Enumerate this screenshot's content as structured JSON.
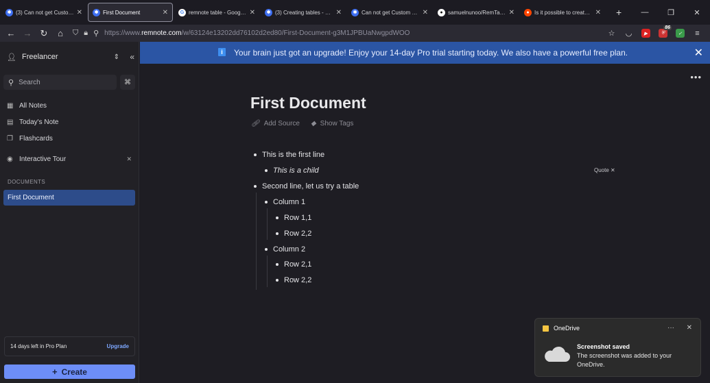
{
  "browser": {
    "tabs": [
      {
        "title": "(3) Can not get Custom CSS",
        "icon": "remnote-icon",
        "active": false
      },
      {
        "title": "First Document",
        "icon": "remnote-icon",
        "active": true
      },
      {
        "title": "remnote table - Google Search",
        "icon": "google-icon",
        "active": false
      },
      {
        "title": "(3) Creating tables - Extensions",
        "icon": "remnote-icon",
        "active": false
      },
      {
        "title": "Can not get Custom CSS",
        "icon": "remnote-icon",
        "active": false
      },
      {
        "title": "samuelnunoo/RemTable",
        "icon": "github-icon",
        "active": false
      },
      {
        "title": "Is it possible to create tables",
        "icon": "reddit-icon",
        "active": false
      }
    ],
    "url_prefix": "https://www.",
    "url_host": "remnote.com",
    "url_path": "/w/63124e13202dd76102d2ed80/First-Document-g3M1JPBUaNwgpdWOO",
    "extension_badge": "86"
  },
  "sidebar": {
    "workspace": "Freelancer",
    "search_placeholder": "Search",
    "search_shortcut": "⌘",
    "nav": [
      {
        "label": "All Notes",
        "icon": "grid-icon"
      },
      {
        "label": "Today's Note",
        "icon": "calendar-icon"
      },
      {
        "label": "Flashcards",
        "icon": "cards-icon"
      },
      {
        "label": "Interactive Tour",
        "icon": "rocket-icon"
      }
    ],
    "documents_header": "DOCUMENTS",
    "documents": [
      "First Document"
    ],
    "trial_text": "14 days left in Pro Plan",
    "upgrade_label": "Upgrade",
    "create_label": "Create"
  },
  "banner": {
    "message": "Your brain just got an upgrade! Enjoy your 14-day Pro trial starting today. We also have a powerful free plan."
  },
  "document": {
    "title": "First Document",
    "add_source": "Add Source",
    "show_tags": "Show Tags",
    "quote_label": "Quote",
    "bullets": [
      {
        "text": "This is the first line",
        "level": 0
      },
      {
        "text": "This is a child",
        "level": 1
      },
      {
        "text": "Second line, let us try a table",
        "level": 0
      },
      {
        "text": "Column 1",
        "level": 1
      },
      {
        "text": "Row 1,1",
        "level": 2
      },
      {
        "text": "Row 2,2",
        "level": 2
      },
      {
        "text": "Column 2",
        "level": 1
      },
      {
        "text": "Row 2,1",
        "level": 2
      },
      {
        "text": "Row 2,2",
        "level": 2
      }
    ]
  },
  "notification": {
    "app": "OneDrive",
    "title": "Screenshot saved",
    "body": "The screenshot was added to your OneDrive."
  },
  "colors": {
    "banner": "#2b55a4",
    "accent": "#6d8ef7",
    "selected_doc": "#2d4c8a"
  }
}
